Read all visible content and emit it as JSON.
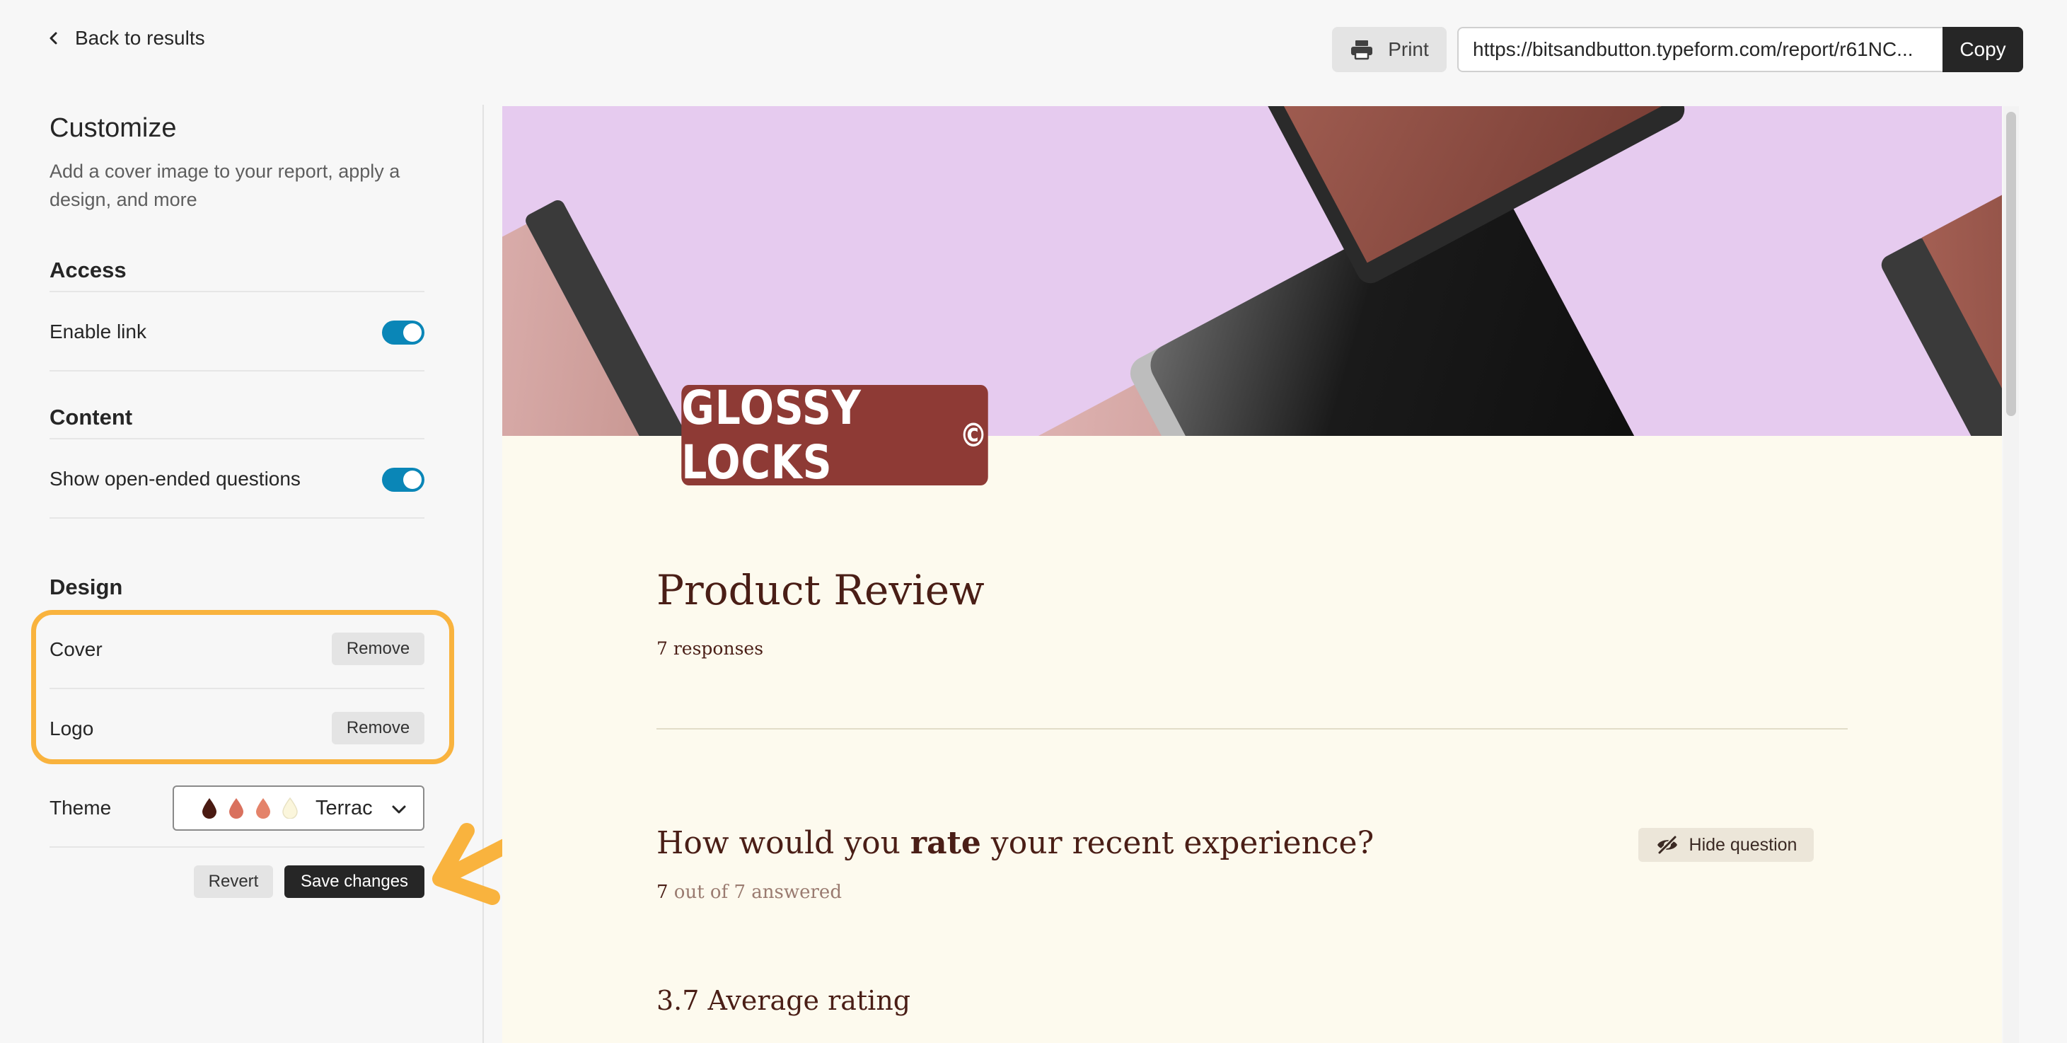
{
  "topbar": {
    "back_label": "Back to results",
    "print_label": "Print",
    "share_url": "https://bitsandbutton.typeform.com/report/r61NC...",
    "copy_label": "Copy"
  },
  "sidebar": {
    "title": "Customize",
    "subtitle": "Add a cover image to your report, apply a design, and more",
    "access": {
      "heading": "Access",
      "enable_link_label": "Enable link",
      "enable_link_on": true
    },
    "content": {
      "heading": "Content",
      "open_ended_label": "Show open-ended questions",
      "open_ended_on": true
    },
    "design": {
      "heading": "Design",
      "cover_label": "Cover",
      "cover_remove": "Remove",
      "logo_label": "Logo",
      "logo_remove": "Remove",
      "theme_label": "Theme",
      "theme_value": "Terrac",
      "theme_colors": [
        "#4a1a12",
        "#d9715e",
        "#e4836a",
        "#fbf6dc"
      ]
    },
    "revert_label": "Revert",
    "save_label": "Save changes"
  },
  "report": {
    "logo_text": "GLOSSY LOCKS",
    "logo_mark": "©",
    "title": "Product Review",
    "responses": "7 responses",
    "question": {
      "title_pre": "How would you ",
      "title_bold": "rate",
      "title_post": " your recent experience?",
      "answered_count": "7",
      "answered_rest": " out of 7 answered",
      "hide_label": "Hide question"
    },
    "average": "3.7 Average rating"
  },
  "colors": {
    "accent_toggle": "#0a86b7",
    "highlight": "#f9b33e",
    "cover_bg": "#e6cbef",
    "logo_bg": "#8e3a35",
    "report_bg": "#fdfaee",
    "report_text": "#4a1e16"
  }
}
